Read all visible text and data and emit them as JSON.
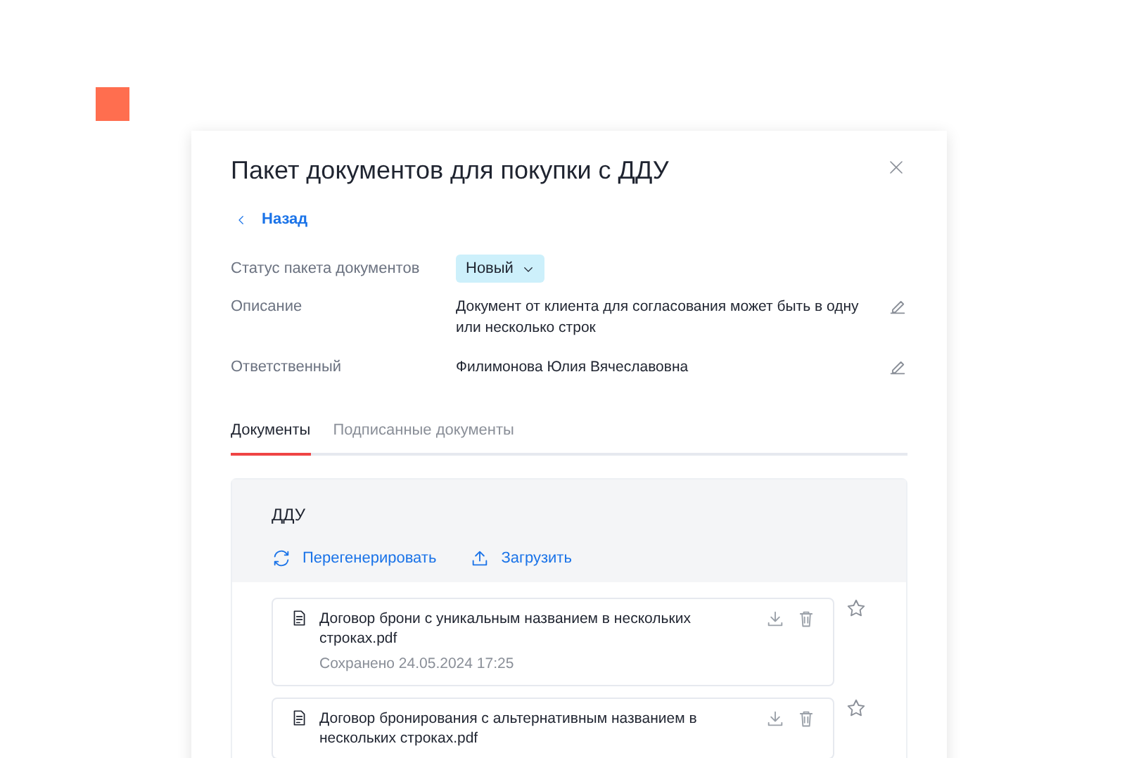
{
  "dialog": {
    "title": "Пакет документов для покупки с ДДУ",
    "back_link": "Назад"
  },
  "fields": [
    {
      "kind": "status",
      "label": "Статус пакета документов",
      "value": "Новый"
    },
    {
      "kind": "text",
      "label": "Описание",
      "value": "Документ от клиента для согласования может быть в одну или несколько строк"
    },
    {
      "kind": "text",
      "label": "Ответственный",
      "value": "Филимонова Юлия Вячеславовна"
    }
  ],
  "tabs": [
    {
      "label": "Документы",
      "selected": true
    },
    {
      "label": "Подписанные документы",
      "selected": false
    }
  ],
  "section": {
    "title": "ДДУ",
    "actions": [
      {
        "kind": "regenerate",
        "label": "Перегенерировать"
      },
      {
        "kind": "upload",
        "label": "Загрузить"
      }
    ],
    "documents": [
      {
        "name": "Договор брони с уникальным названием в нескольких строках.pdf",
        "saved": "Сохранено 24.05.2024 17:25",
        "starred": false
      },
      {
        "name": "Договор бронирования с альтернативным названием в нескольких строках.pdf",
        "starred": false
      }
    ]
  }
}
